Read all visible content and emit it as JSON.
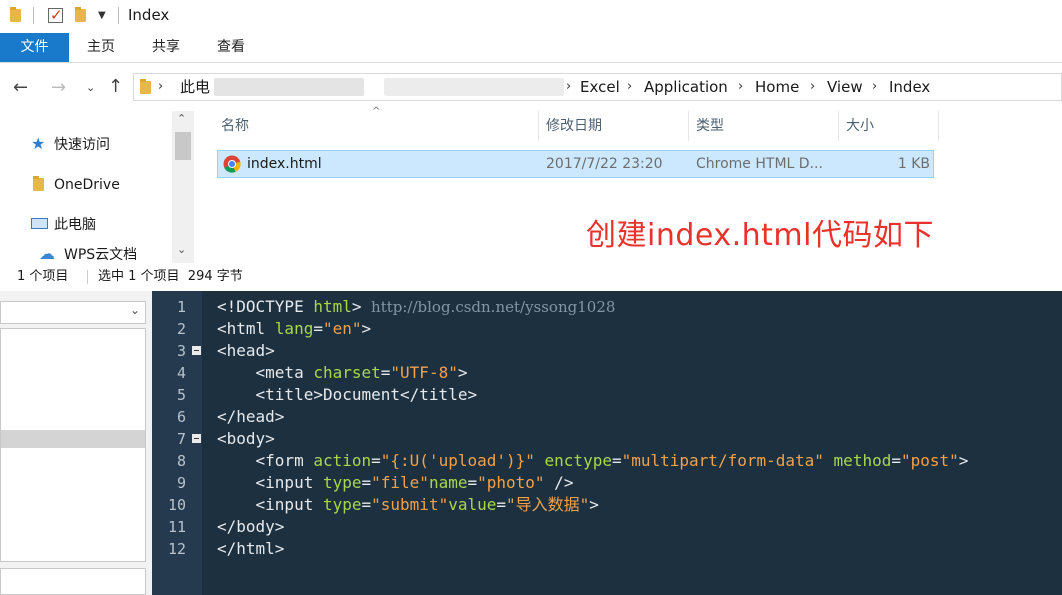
{
  "window": {
    "title": "Index"
  },
  "ribbon": {
    "tabs": [
      "文件",
      "主页",
      "共享",
      "查看"
    ]
  },
  "address": {
    "crumbs": [
      "此电",
      "Excel",
      "Application",
      "Home",
      "View",
      "Index"
    ]
  },
  "nav": {
    "items": [
      {
        "label": "快速访问",
        "icon": "star-icon"
      },
      {
        "label": "OneDrive",
        "icon": "folder-icon"
      },
      {
        "label": "此电脑",
        "icon": "computer-icon"
      },
      {
        "label": "WPS云文档",
        "icon": "cloud-icon"
      }
    ]
  },
  "list": {
    "headers": {
      "name": "名称",
      "date": "修改日期",
      "type": "类型",
      "size": "大小"
    },
    "files": [
      {
        "name": "index.html",
        "date": "2017/7/22 23:20",
        "type": "Chrome HTML D...",
        "size": "1 KB",
        "icon": "chrome-icon"
      }
    ]
  },
  "status": {
    "count": "1 个项目",
    "selection": "选中 1 个项目  294 字节"
  },
  "annotation": "创建index.html代码如下",
  "editor": {
    "line_numbers": [
      "1",
      "2",
      "3",
      "4",
      "5",
      "6",
      "7",
      "8",
      "9",
      "10",
      "11",
      "12"
    ],
    "watermark": "http://blog.csdn.net/yssong1028",
    "lines": [
      {
        "indent": "",
        "parts": [
          [
            "kw",
            "<!DOCTYPE "
          ],
          [
            "at",
            "html"
          ],
          [
            "kw",
            ">"
          ]
        ]
      },
      {
        "indent": "",
        "parts": [
          [
            "kw",
            "<html "
          ],
          [
            "at",
            "lang"
          ],
          [
            "kw",
            "="
          ],
          [
            "st-str",
            "\"en\""
          ],
          [
            "kw",
            ">"
          ]
        ]
      },
      {
        "indent": "",
        "parts": [
          [
            "kw",
            "<head>"
          ]
        ]
      },
      {
        "indent": "    ",
        "parts": [
          [
            "kw",
            "<meta "
          ],
          [
            "at",
            "charset"
          ],
          [
            "kw",
            "="
          ],
          [
            "st-str",
            "\"UTF-8\""
          ],
          [
            "kw",
            ">"
          ]
        ]
      },
      {
        "indent": "    ",
        "parts": [
          [
            "kw",
            "<title>Document</title>"
          ]
        ]
      },
      {
        "indent": "",
        "parts": [
          [
            "kw",
            "</head>"
          ]
        ]
      },
      {
        "indent": "",
        "parts": [
          [
            "kw",
            "<body>"
          ]
        ]
      },
      {
        "indent": "    ",
        "parts": [
          [
            "kw",
            "<form "
          ],
          [
            "at",
            "action"
          ],
          [
            "kw",
            "="
          ],
          [
            "st-str",
            "\"{:U('upload')}\""
          ],
          [
            "kw",
            " "
          ],
          [
            "at",
            "enctype"
          ],
          [
            "kw",
            "="
          ],
          [
            "st-str",
            "\"multipart/form-data\""
          ],
          [
            "kw",
            " "
          ],
          [
            "at",
            "method"
          ],
          [
            "kw",
            "="
          ],
          [
            "st-str",
            "\"post\""
          ],
          [
            "kw",
            ">"
          ]
        ]
      },
      {
        "indent": "    ",
        "parts": [
          [
            "kw",
            "<input "
          ],
          [
            "at",
            "type"
          ],
          [
            "kw",
            "="
          ],
          [
            "st-str",
            "\"file\""
          ],
          [
            "at",
            "name"
          ],
          [
            "kw",
            "="
          ],
          [
            "st-str",
            "\"photo\""
          ],
          [
            "kw",
            " />"
          ]
        ]
      },
      {
        "indent": "    ",
        "parts": [
          [
            "kw",
            "<input "
          ],
          [
            "at",
            "type"
          ],
          [
            "kw",
            "="
          ],
          [
            "st-str",
            "\"submit\""
          ],
          [
            "at",
            "value"
          ],
          [
            "kw",
            "="
          ],
          [
            "st-str",
            "\"导入数据\""
          ],
          [
            "kw",
            ">"
          ]
        ]
      },
      {
        "indent": "",
        "parts": [
          [
            "kw",
            "</body>"
          ]
        ]
      },
      {
        "indent": "",
        "parts": [
          [
            "kw",
            "</html>"
          ]
        ]
      }
    ]
  },
  "colors": {
    "accent": "#1979ca",
    "selection": "#cce8ff",
    "annotation": "#e8322b",
    "editor_bg": "#1d3040"
  }
}
